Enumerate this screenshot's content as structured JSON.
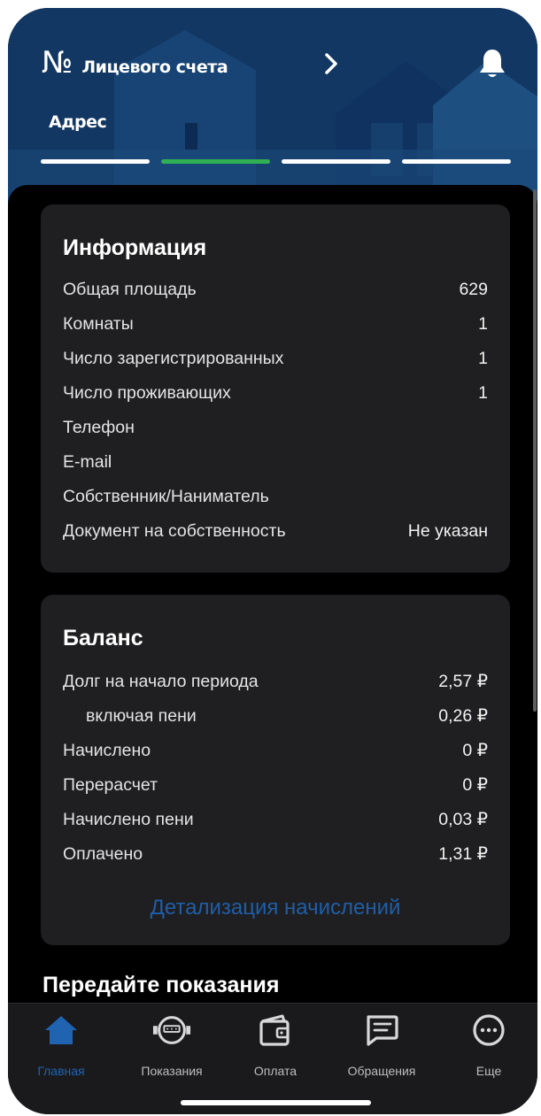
{
  "header": {
    "account_no": "№",
    "account_label": "Лицевого счета",
    "address": "Адрес",
    "pager": {
      "count": 4,
      "active_index": 1
    },
    "colors": {
      "accent_green": "#2fb153",
      "header_blue": "#16426f"
    }
  },
  "info": {
    "title": "Информация",
    "rows": [
      {
        "label": "Общая площадь",
        "value": "629"
      },
      {
        "label": "Комнаты",
        "value": "1"
      },
      {
        "label": "Число зарегистрированных",
        "value": "1"
      },
      {
        "label": "Число проживающих",
        "value": "1"
      },
      {
        "label": "Телефон",
        "value": ""
      },
      {
        "label": "E-mail",
        "value": ""
      },
      {
        "label": "Собственник/Наниматель",
        "value": ""
      },
      {
        "label": "Документ на собственность",
        "value": "Не указан"
      }
    ]
  },
  "balance": {
    "title": "Баланс",
    "rows": [
      {
        "label": "Долг на начало периода",
        "value": "2,57 ₽"
      },
      {
        "label": "включая пени",
        "value": "0,26 ₽"
      },
      {
        "label": "Начислено",
        "value": "0 ₽"
      },
      {
        "label": "Перерасчет",
        "value": "0 ₽"
      },
      {
        "label": "Начислено пени",
        "value": "0,03 ₽"
      },
      {
        "label": "Оплачено",
        "value": "1,31 ₽"
      }
    ],
    "detail_link": "Детализация начислений"
  },
  "readings_section": {
    "title": "Передайте показания"
  },
  "tabs": [
    {
      "label": "Главная",
      "icon": "home-icon",
      "active": true
    },
    {
      "label": "Показания",
      "icon": "meter-icon",
      "active": false
    },
    {
      "label": "Оплата",
      "icon": "wallet-icon",
      "active": false
    },
    {
      "label": "Обращения",
      "icon": "message-icon",
      "active": false
    },
    {
      "label": "Еще",
      "icon": "more-icon",
      "active": false
    }
  ]
}
